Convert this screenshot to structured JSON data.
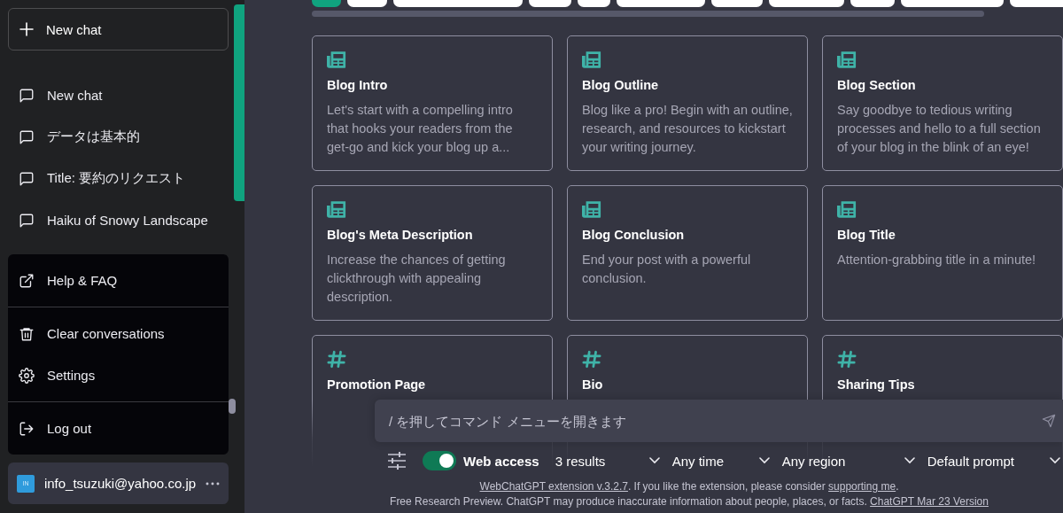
{
  "sidebar": {
    "new_chat": "New chat",
    "chats": [
      {
        "title": "New chat"
      },
      {
        "title": "データは基本的"
      },
      {
        "title": "Title: 要約のリクエスト"
      },
      {
        "title": "Haiku of Snowy Landscape"
      }
    ],
    "menu": [
      [
        {
          "kind": "external",
          "label": "Help & FAQ"
        }
      ],
      [
        {
          "kind": "trash",
          "label": "Clear conversations"
        },
        {
          "kind": "gear",
          "label": "Settings"
        }
      ],
      [
        {
          "kind": "logout",
          "label": "Log out"
        }
      ]
    ],
    "user": {
      "avatar": "IN",
      "email": "info_tsuzuki@yahoo.co.jp"
    }
  },
  "chips": [
    {
      "selected": true
    },
    {
      "selected": false
    },
    {
      "selected": false
    },
    {
      "selected": false
    },
    {
      "selected": false
    },
    {
      "selected": false
    },
    {
      "selected": false
    },
    {
      "selected": false
    },
    {
      "selected": false
    },
    {
      "selected": false
    },
    {
      "selected": false
    }
  ],
  "cards": [
    {
      "kind": "newspaper",
      "title": "Blog Intro",
      "description": "Let's start with a compelling intro that hooks your readers from the get-go and kick your blog up a..."
    },
    {
      "kind": "newspaper",
      "title": "Blog Outline",
      "description": "Blog like a pro! Begin with an outline, research, and resources to kickstart your writing journey."
    },
    {
      "kind": "newspaper",
      "title": "Blog Section",
      "description": "Say goodbye to tedious writing processes and hello to a full section of your blog in the blink of an eye!"
    },
    {
      "kind": "newspaper",
      "title": "Blog's Meta Description",
      "description": "Increase the chances of getting clickthrough with appealing description."
    },
    {
      "kind": "newspaper",
      "title": "Blog Conclusion",
      "description": "End your post with a powerful conclusion."
    },
    {
      "kind": "newspaper",
      "title": "Blog Title",
      "description": "Attention-grabbing title in a minute!"
    },
    {
      "kind": "hash",
      "title": "Promotion Page"
    },
    {
      "kind": "hash",
      "title": "Bio"
    },
    {
      "kind": "hash",
      "title": "Sharing Tips"
    }
  ],
  "prompt": {
    "placeholder": "/ を押してコマンド メニューを開きます"
  },
  "toolbar": {
    "web_access": {
      "label": "Web access",
      "on": true
    },
    "selects": [
      {
        "value": "3 results"
      },
      {
        "value": "Any time"
      },
      {
        "value": "Any region"
      },
      {
        "value": "Default prompt"
      }
    ]
  },
  "footer": {
    "line1": [
      {
        "kind": "link",
        "text": "WebChatGPT extension v.3.2.7"
      },
      {
        "kind": "text",
        "text": ". If you like the extension, please consider "
      },
      {
        "kind": "link",
        "text": "supporting me"
      },
      {
        "kind": "text",
        "text": "."
      }
    ],
    "line2": [
      {
        "kind": "text",
        "text": "Free Research Preview. ChatGPT may produce inaccurate information about people, places, or facts. "
      },
      {
        "kind": "link",
        "text": "ChatGPT Mar 23 Version"
      }
    ]
  }
}
